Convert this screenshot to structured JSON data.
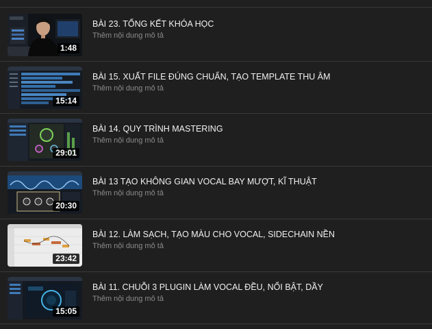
{
  "lessons": [
    {
      "title": "BÀI 23. TỔNG KẾT KHÓA HỌC",
      "description": "Thêm nội dung mô tả",
      "duration": "1:48",
      "thumbnail": "presenter-thumbnail"
    },
    {
      "title": "BÀI 15. XUẤT FILE ĐÚNG CHUẨN, TẠO TEMPLATE THU ÂM",
      "description": "Thêm nội dung mô tả",
      "duration": "15:14",
      "thumbnail": "daw-mixer-thumbnail"
    },
    {
      "title": "BÀI 14. QUY TRÌNH MASTERING",
      "description": "Thêm nội dung mô tả",
      "duration": "29:01",
      "thumbnail": "mastering-plugin-thumbnail"
    },
    {
      "title": "BÀI 13 TẠO KHÔNG GIAN VOCAL BAY MƯỢT, KĨ THUẬT",
      "description": "Thêm nội dung mô tả",
      "duration": "20:30",
      "thumbnail": "reverb-plugin-thumbnail"
    },
    {
      "title": "BÀI 12. LÀM SẠCH, TẠO MÀU CHO VOCAL, SIDECHAIN NỀN",
      "description": "Thêm nội dung mô tả",
      "duration": "23:42",
      "thumbnail": "pitch-editor-thumbnail"
    },
    {
      "title": "BÀI 11. CHUỖI 3 PLUGIN LÀM VOCAL ĐỀU, NỔI BẬT, DẦY",
      "description": "Thêm nội dung mô tả",
      "duration": "15:05",
      "thumbnail": "vocal-plugin-thumbnail"
    }
  ]
}
